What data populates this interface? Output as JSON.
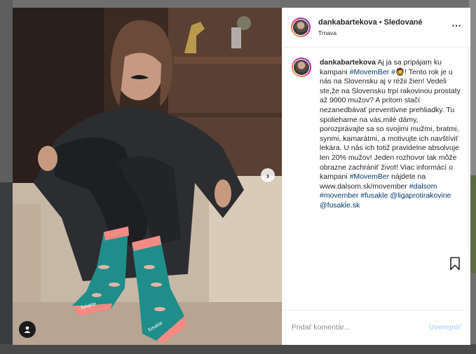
{
  "post": {
    "username": "dankabartekova",
    "separator": "•",
    "follow_status": "Sledované",
    "location": "Trnava",
    "more_icon": "⋯"
  },
  "caption": {
    "username": "dankabartekova",
    "parts": [
      {
        "type": "text",
        "text": "Aj ja sa pripájam ku kampani "
      },
      {
        "type": "tag",
        "text": "#MovemBer"
      },
      {
        "type": "text",
        "text": " "
      },
      {
        "type": "tag",
        "text": "#🧔"
      },
      {
        "type": "text",
        "text": "! Tento rok je u nás na Slovensku aj v réžii žien! Vedeli ste,že na Slovensku trpí rakovinou prostaty až 9000 mužov? A pritom stačí nezanedbávať preventívne prehliadky. Tu spoliehame na vás,milé dámy, porozprávajte sa so svojimi mužmi, bratmi, synmi, kamarátmi, a motivujte ich navštíviť lekára. U nás ich totiž pravidelne absolvuje len 20% mužov! Jeden rozhovor tak môže obrazne zachrániť život! Viac informácí o kampani "
      },
      {
        "type": "tag",
        "text": "#MovemBer"
      },
      {
        "type": "text",
        "text": " nájdete na www.dalsom.sk/movember "
      },
      {
        "type": "tag",
        "text": "#dalsom"
      },
      {
        "type": "text",
        "text": " "
      },
      {
        "type": "tag",
        "text": "#movember"
      },
      {
        "type": "text",
        "text": " "
      },
      {
        "type": "tag",
        "text": "#fusakle"
      },
      {
        "type": "text",
        "text": " "
      },
      {
        "type": "tag",
        "text": "@ligaprotirakovine"
      },
      {
        "type": "text",
        "text": " "
      },
      {
        "type": "tag",
        "text": "@fusakle.sk"
      }
    ]
  },
  "comment": {
    "placeholder": "Pridať komentár...",
    "post_label": "Uverejniť"
  },
  "photo": {
    "sock_brand": "fusakle",
    "next_icon": "›"
  },
  "colors": {
    "link": "#00376b",
    "post_button_disabled": "#b3dbff",
    "sock_teal": "#1f8e8a",
    "sock_pink": "#f38b84"
  }
}
